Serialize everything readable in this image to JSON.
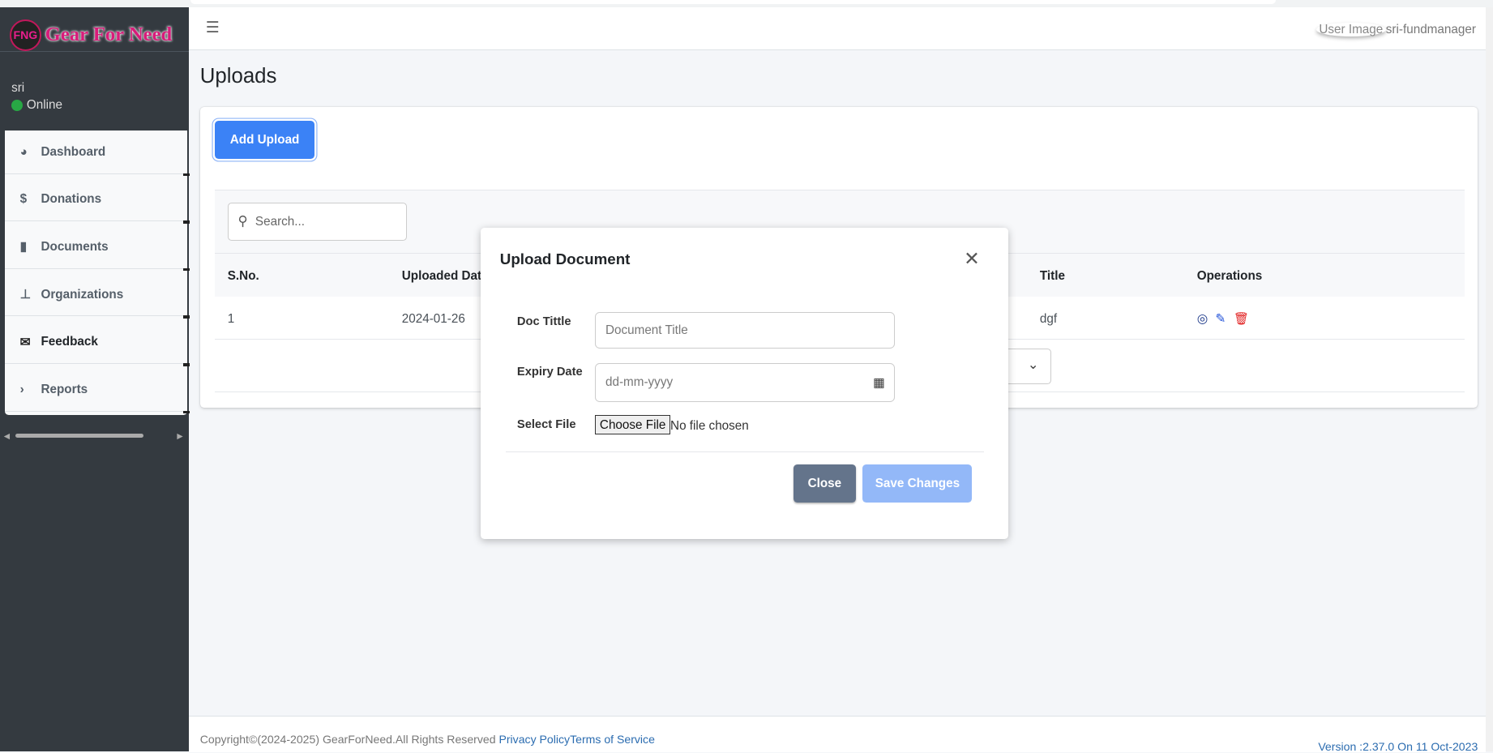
{
  "app": {
    "logo_text": "Gear For Need",
    "logo_mark": "FNG"
  },
  "sidebar": {
    "user": "sri",
    "status": "Online",
    "items": [
      {
        "label": "Dashboard",
        "icon": "chart-pie-icon"
      },
      {
        "label": "Donations",
        "icon": "donate-icon"
      },
      {
        "label": "Documents",
        "icon": "file-icon"
      },
      {
        "label": "Organizations",
        "icon": "sitemap-icon"
      },
      {
        "label": "Feedback",
        "icon": "envelope-icon"
      },
      {
        "label": "Reports",
        "icon": "chevron-right-icon"
      }
    ]
  },
  "header": {
    "user_image_alt": "User Image",
    "username": "sri-fundmanager"
  },
  "page": {
    "title": "Uploads",
    "add_button": "Add Upload",
    "search_placeholder": "Search...",
    "columns": [
      "S.No.",
      "Uploaded Dat",
      "Title",
      "Operations"
    ],
    "rows": [
      {
        "sno": "1",
        "date": "2024-01-26",
        "title": "dgf"
      }
    ],
    "page_size_partial": "0"
  },
  "modal": {
    "title": "Upload Document",
    "fields": {
      "doc_title_label": "Doc Tittle",
      "doc_title_placeholder": "Document Title",
      "expiry_label": "Expiry Date",
      "expiry_placeholder": "dd-mm-yyyy",
      "file_label": "Select File",
      "choose_file": "Choose File",
      "no_file": "No file chosen"
    },
    "close": "Close",
    "save": "Save Changes"
  },
  "footer": {
    "copyright": "Copyright©(2024-2025) GearForNeed.All Rights Reserved ",
    "privacy": "Privacy Policy",
    "terms": "Terms of Service",
    "version": "Version :2.37.0 On 11 Oct-2023"
  },
  "colors": {
    "primary": "#3b82f6",
    "sidebar": "#343a40",
    "online": "#28a745",
    "delete": "#e11d1d",
    "edit": "#1e3a8a"
  }
}
